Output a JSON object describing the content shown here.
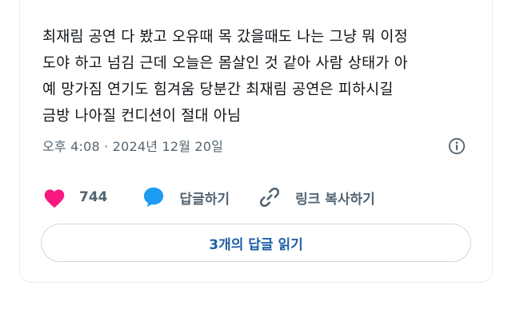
{
  "tweet": {
    "lines": [
      "최재림 공연 다 봤고 오유때 목 갔을때도 나는 그냥 뭐 이정",
      "도야 하고 넘김 근데 오늘은 몸살인 것 같아 사람 상태가 아",
      "예 망가짐 연기도 힘겨움 당분간 최재림 공연은 피하시길",
      "금방 나아질 컨디션이 절대 아님"
    ],
    "timestamp": "오후 4:08 · 2024년 12월 20일"
  },
  "actions": {
    "like_count": "744",
    "reply_label": "답글하기",
    "copy_link_label": "링크 복사하기"
  },
  "replies_button": {
    "label": "3개의 답글 읽기"
  },
  "colors": {
    "heart": "#f91880",
    "reply_bubble": "#1d9bf0",
    "muted_text": "#536471",
    "link_blue": "#1d5fa8"
  },
  "icons": [
    "heart-icon",
    "speech-bubble-icon",
    "link-icon",
    "info-icon"
  ]
}
